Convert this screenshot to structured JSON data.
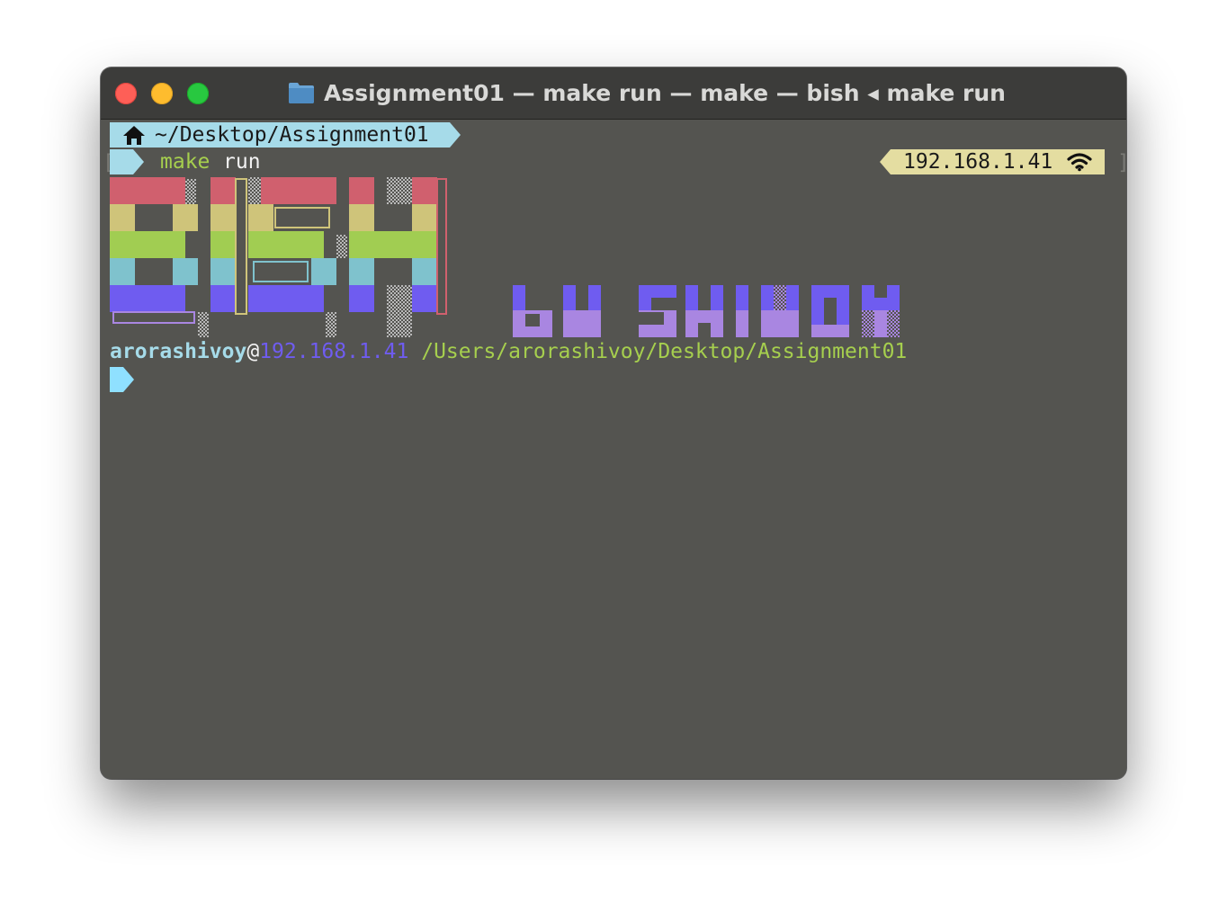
{
  "window": {
    "title": "Assignment01 — make run — make — bish ◂ make run",
    "folder_icon": "folder-icon",
    "colors": {
      "background": "#545450",
      "titlebar": "#3c3c3a"
    }
  },
  "prompt": {
    "home_icon": "home-icon",
    "directory": "~/Desktop/Assignment01",
    "command_keyword": "make",
    "command_arg": "run",
    "bracket_open": "[",
    "bracket_close": "]",
    "ip": "192.168.1.41",
    "wifi_icon": "wifi-icon",
    "colors": {
      "dir_segment": "#a6dbe9",
      "ip_segment": "#e4dda1",
      "command": "#a6cf4e"
    }
  },
  "banner": {
    "main_word": "BISH",
    "byline": "by SHIVOY",
    "stripe_colors": [
      "#d0606e",
      "#cfc47a",
      "#a1cd52",
      "#7fc2cd",
      "#6f5cf0"
    ],
    "byline_colors": [
      "#6f5cf0",
      "#a986e1"
    ]
  },
  "shell": {
    "user": "arorashivoy",
    "at": "@",
    "host": "192.168.1.41",
    "path": "/Users/arorashivoy/Desktop/Assignment01",
    "prompt_icon": "prompt-arrow-icon",
    "colors": {
      "user": "#a6dbe9",
      "host": "#6f5cf0",
      "path": "#a6cf4e"
    }
  }
}
